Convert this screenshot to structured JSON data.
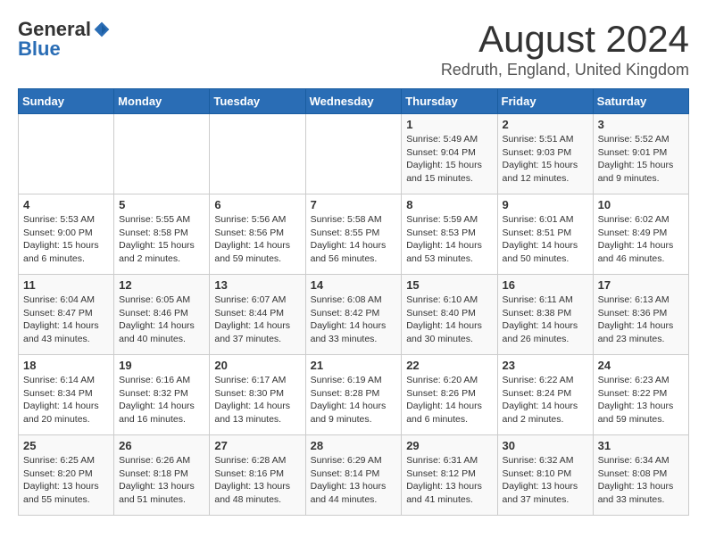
{
  "logo": {
    "general": "General",
    "blue": "Blue"
  },
  "title": "August 2024",
  "subtitle": "Redruth, England, United Kingdom",
  "days_of_week": [
    "Sunday",
    "Monday",
    "Tuesday",
    "Wednesday",
    "Thursday",
    "Friday",
    "Saturday"
  ],
  "weeks": [
    [
      {
        "day": "",
        "info": ""
      },
      {
        "day": "",
        "info": ""
      },
      {
        "day": "",
        "info": ""
      },
      {
        "day": "",
        "info": ""
      },
      {
        "day": "1",
        "info": "Sunrise: 5:49 AM\nSunset: 9:04 PM\nDaylight: 15 hours and 15 minutes."
      },
      {
        "day": "2",
        "info": "Sunrise: 5:51 AM\nSunset: 9:03 PM\nDaylight: 15 hours and 12 minutes."
      },
      {
        "day": "3",
        "info": "Sunrise: 5:52 AM\nSunset: 9:01 PM\nDaylight: 15 hours and 9 minutes."
      }
    ],
    [
      {
        "day": "4",
        "info": "Sunrise: 5:53 AM\nSunset: 9:00 PM\nDaylight: 15 hours and 6 minutes."
      },
      {
        "day": "5",
        "info": "Sunrise: 5:55 AM\nSunset: 8:58 PM\nDaylight: 15 hours and 2 minutes."
      },
      {
        "day": "6",
        "info": "Sunrise: 5:56 AM\nSunset: 8:56 PM\nDaylight: 14 hours and 59 minutes."
      },
      {
        "day": "7",
        "info": "Sunrise: 5:58 AM\nSunset: 8:55 PM\nDaylight: 14 hours and 56 minutes."
      },
      {
        "day": "8",
        "info": "Sunrise: 5:59 AM\nSunset: 8:53 PM\nDaylight: 14 hours and 53 minutes."
      },
      {
        "day": "9",
        "info": "Sunrise: 6:01 AM\nSunset: 8:51 PM\nDaylight: 14 hours and 50 minutes."
      },
      {
        "day": "10",
        "info": "Sunrise: 6:02 AM\nSunset: 8:49 PM\nDaylight: 14 hours and 46 minutes."
      }
    ],
    [
      {
        "day": "11",
        "info": "Sunrise: 6:04 AM\nSunset: 8:47 PM\nDaylight: 14 hours and 43 minutes."
      },
      {
        "day": "12",
        "info": "Sunrise: 6:05 AM\nSunset: 8:46 PM\nDaylight: 14 hours and 40 minutes."
      },
      {
        "day": "13",
        "info": "Sunrise: 6:07 AM\nSunset: 8:44 PM\nDaylight: 14 hours and 37 minutes."
      },
      {
        "day": "14",
        "info": "Sunrise: 6:08 AM\nSunset: 8:42 PM\nDaylight: 14 hours and 33 minutes."
      },
      {
        "day": "15",
        "info": "Sunrise: 6:10 AM\nSunset: 8:40 PM\nDaylight: 14 hours and 30 minutes."
      },
      {
        "day": "16",
        "info": "Sunrise: 6:11 AM\nSunset: 8:38 PM\nDaylight: 14 hours and 26 minutes."
      },
      {
        "day": "17",
        "info": "Sunrise: 6:13 AM\nSunset: 8:36 PM\nDaylight: 14 hours and 23 minutes."
      }
    ],
    [
      {
        "day": "18",
        "info": "Sunrise: 6:14 AM\nSunset: 8:34 PM\nDaylight: 14 hours and 20 minutes."
      },
      {
        "day": "19",
        "info": "Sunrise: 6:16 AM\nSunset: 8:32 PM\nDaylight: 14 hours and 16 minutes."
      },
      {
        "day": "20",
        "info": "Sunrise: 6:17 AM\nSunset: 8:30 PM\nDaylight: 14 hours and 13 minutes."
      },
      {
        "day": "21",
        "info": "Sunrise: 6:19 AM\nSunset: 8:28 PM\nDaylight: 14 hours and 9 minutes."
      },
      {
        "day": "22",
        "info": "Sunrise: 6:20 AM\nSunset: 8:26 PM\nDaylight: 14 hours and 6 minutes."
      },
      {
        "day": "23",
        "info": "Sunrise: 6:22 AM\nSunset: 8:24 PM\nDaylight: 14 hours and 2 minutes."
      },
      {
        "day": "24",
        "info": "Sunrise: 6:23 AM\nSunset: 8:22 PM\nDaylight: 13 hours and 59 minutes."
      }
    ],
    [
      {
        "day": "25",
        "info": "Sunrise: 6:25 AM\nSunset: 8:20 PM\nDaylight: 13 hours and 55 minutes."
      },
      {
        "day": "26",
        "info": "Sunrise: 6:26 AM\nSunset: 8:18 PM\nDaylight: 13 hours and 51 minutes."
      },
      {
        "day": "27",
        "info": "Sunrise: 6:28 AM\nSunset: 8:16 PM\nDaylight: 13 hours and 48 minutes."
      },
      {
        "day": "28",
        "info": "Sunrise: 6:29 AM\nSunset: 8:14 PM\nDaylight: 13 hours and 44 minutes."
      },
      {
        "day": "29",
        "info": "Sunrise: 6:31 AM\nSunset: 8:12 PM\nDaylight: 13 hours and 41 minutes."
      },
      {
        "day": "30",
        "info": "Sunrise: 6:32 AM\nSunset: 8:10 PM\nDaylight: 13 hours and 37 minutes."
      },
      {
        "day": "31",
        "info": "Sunrise: 6:34 AM\nSunset: 8:08 PM\nDaylight: 13 hours and 33 minutes."
      }
    ]
  ]
}
